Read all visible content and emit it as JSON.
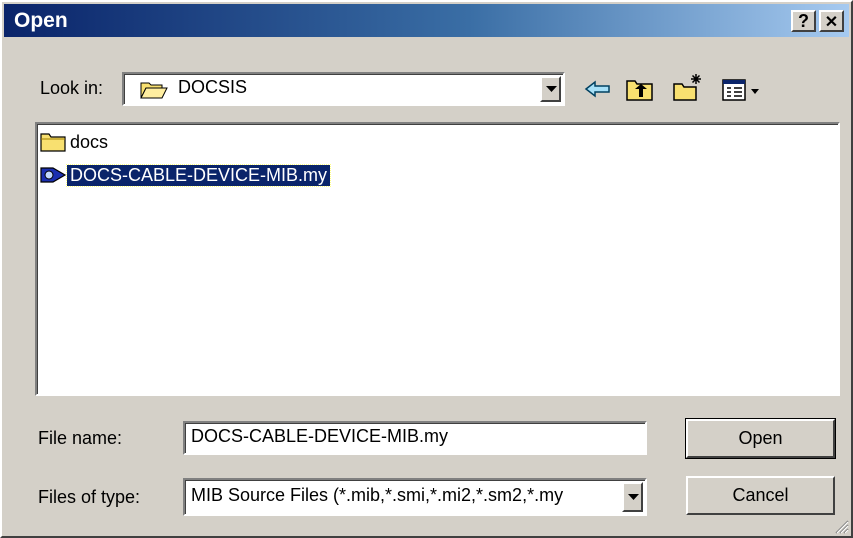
{
  "window": {
    "title": "Open",
    "help_glyph": "?",
    "close_glyph": "✕"
  },
  "toolbar": {
    "look_in_label": "Look in:",
    "look_in_value": "DOCSIS",
    "icons": [
      "back-arrow-icon",
      "up-one-level-icon",
      "new-folder-icon",
      "view-menu-icon"
    ]
  },
  "file_list": {
    "items": [
      {
        "name": "docs",
        "icon": "folder-icon",
        "selected": false
      },
      {
        "name": "DOCS-CABLE-DEVICE-MIB.my",
        "icon": "mib-file-icon",
        "selected": true
      }
    ]
  },
  "file_name": {
    "label": "File name:",
    "value": "DOCS-CABLE-DEVICE-MIB.my"
  },
  "file_type": {
    "label": "Files of type:",
    "value": "MIB Source Files (*.mib,*.smi,*.mi2,*.sm2,*.my"
  },
  "buttons": {
    "open": "Open",
    "cancel": "Cancel"
  },
  "colors": {
    "title_start": "#0a246a",
    "title_end": "#a6caf0",
    "selection": "#0a246a",
    "face": "#d4d0c8"
  }
}
